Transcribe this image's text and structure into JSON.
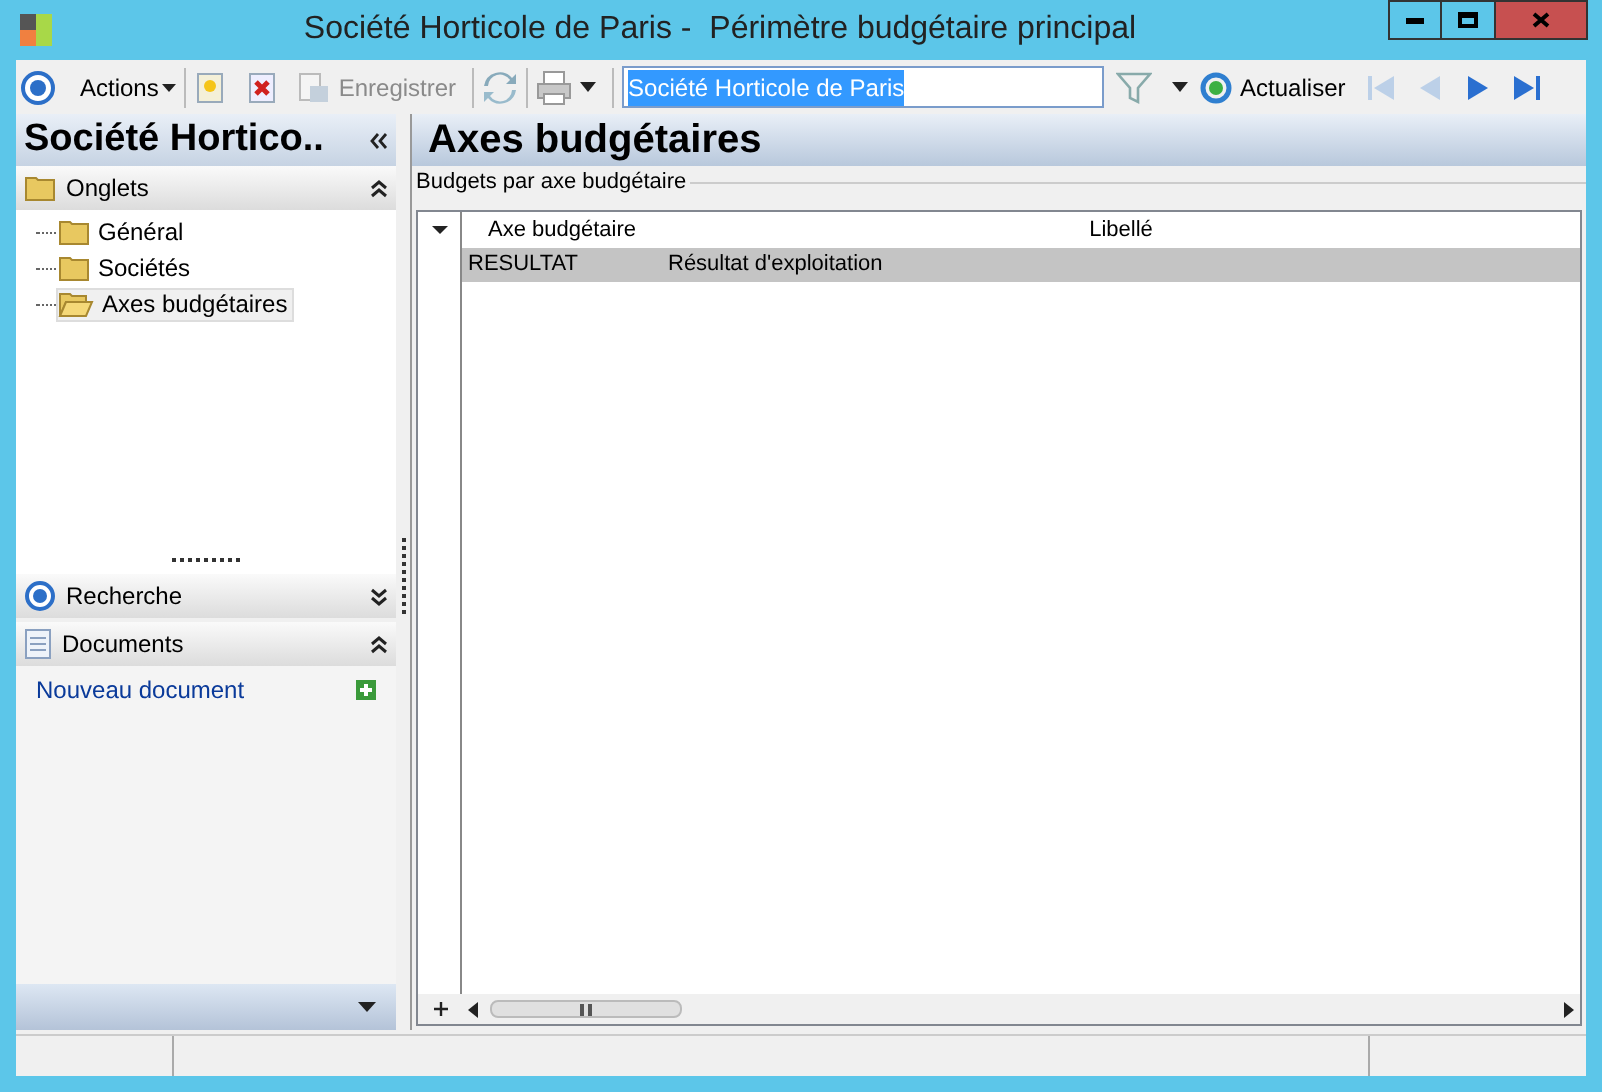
{
  "window": {
    "title": "Société Horticole de Paris -  Périmètre budgétaire principal"
  },
  "toolbar": {
    "actions": "Actions",
    "save": {
      "label": "Enregistrer",
      "disabled": true
    },
    "search_value": "Société Horticole de Paris",
    "refresh": "Actualiser",
    "nav": [
      {
        "kind": "first",
        "disabled": true
      },
      {
        "kind": "prev",
        "disabled": true
      },
      {
        "kind": "next",
        "disabled": false
      },
      {
        "kind": "last",
        "disabled": false
      }
    ]
  },
  "sidebar": {
    "title": "Société Hortico..",
    "onglets": {
      "label": "Onglets",
      "expanded": true,
      "children": [
        {
          "label": "Général",
          "selected": false
        },
        {
          "label": "Sociétés",
          "selected": false
        },
        {
          "label": "Axes budgétaires",
          "selected": true
        }
      ]
    },
    "recherche": {
      "label": "Recherche",
      "expanded": false
    },
    "documents": {
      "label": "Documents",
      "expanded": true,
      "links": [
        "Nouveau document"
      ]
    }
  },
  "main": {
    "title": "Axes budgétaires",
    "group_label": "Budgets par axe budgétaire",
    "table": {
      "columns": [
        "Axe budgétaire",
        "Libellé"
      ],
      "rows": [
        {
          "cells": [
            "RESULTAT",
            "Résultat d'exploitation"
          ],
          "selected": true
        }
      ]
    }
  }
}
